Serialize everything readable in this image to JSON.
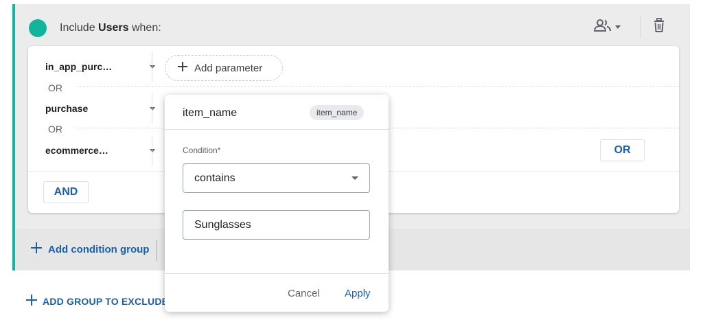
{
  "group": {
    "include_prefix": "Include ",
    "include_bold": "Users",
    "include_suffix": " when:",
    "scope_icon": "people-icon",
    "delete_icon": "trash-icon",
    "accent_color": "#12b5a0"
  },
  "conditions": [
    {
      "event": "in_app_purc…"
    },
    {
      "event": "purchase"
    },
    {
      "event": "ecommerce…"
    }
  ],
  "or_connector": "OR",
  "add_parameter_label": "Add parameter",
  "or_button_label": "OR",
  "and_button_label": "AND",
  "add_condition_group_label": "Add condition group",
  "add_group_to_exclude_label": "ADD GROUP TO EXCLUDE",
  "popup": {
    "title": "item_name",
    "chip": "item_name",
    "condition_label": "Condition*",
    "condition_value": "contains",
    "value_input": "Sunglasses",
    "cancel_label": "Cancel",
    "apply_label": "Apply"
  },
  "colors": {
    "link_blue": "#1a5fa8",
    "status_green": "#12b59c"
  }
}
